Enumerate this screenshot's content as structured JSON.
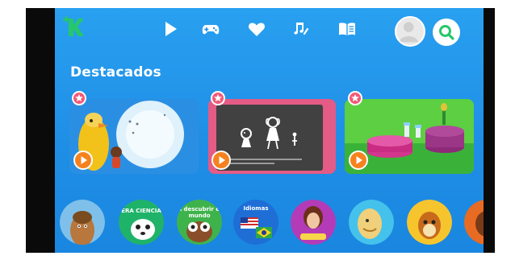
{
  "section": {
    "title": "Destacados"
  },
  "nav": {
    "items": [
      {
        "icon": "play-icon"
      },
      {
        "icon": "gamepad-icon"
      },
      {
        "icon": "heart-icon"
      },
      {
        "icon": "music-icon"
      },
      {
        "icon": "book-icon"
      }
    ]
  },
  "icons": {
    "logo": "kids-logo-icon",
    "avatar": "avatar-icon",
    "search": "search-icon",
    "favorite": "star-badge-icon",
    "play": "play-circle-icon"
  },
  "characters": [
    {
      "label": ""
    },
    {
      "label": "ERA CIENCIA"
    },
    {
      "label": "A descubrir el mundo"
    },
    {
      "label": "Idiomas"
    },
    {
      "label": ""
    },
    {
      "label": ""
    },
    {
      "label": ""
    },
    {
      "label": ""
    }
  ],
  "colors": {
    "background": "#1f8fe6",
    "logo_green": "#26c76a",
    "play_orange": "#f5821f",
    "favorite_pink": "#f25a78",
    "card2_frame": "#e45b85"
  }
}
